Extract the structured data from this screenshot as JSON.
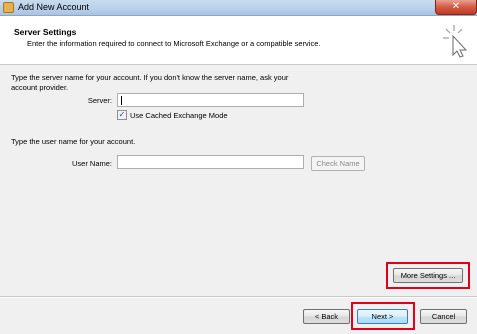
{
  "window": {
    "title": "Add New Account",
    "close_glyph": "✕"
  },
  "header": {
    "title": "Server Settings",
    "description": "Enter the information required to connect to Microsoft Exchange or a compatible service.",
    "icon": "cursor-sparkle-icon"
  },
  "server_section": {
    "instructions_line1": "Type the server name for your account. If you don't know the server name, ask your",
    "instructions_line2": "account provider.",
    "server_label": "Server:",
    "server_value": "",
    "cached_mode_label": "Use Cached Exchange Mode",
    "cached_mode_checked": true,
    "check_glyph": "✓"
  },
  "user_section": {
    "instructions": "Type the user name for your account.",
    "username_label": "User Name:",
    "username_value": "",
    "check_name_label": "Check Name"
  },
  "buttons": {
    "more_settings": "More Settings ...",
    "back": "< Back",
    "next": "Next >",
    "cancel": "Cancel"
  },
  "colors": {
    "highlight": "#e0001a",
    "titlebar": "#b9d1ea",
    "close": "#d35b44"
  }
}
